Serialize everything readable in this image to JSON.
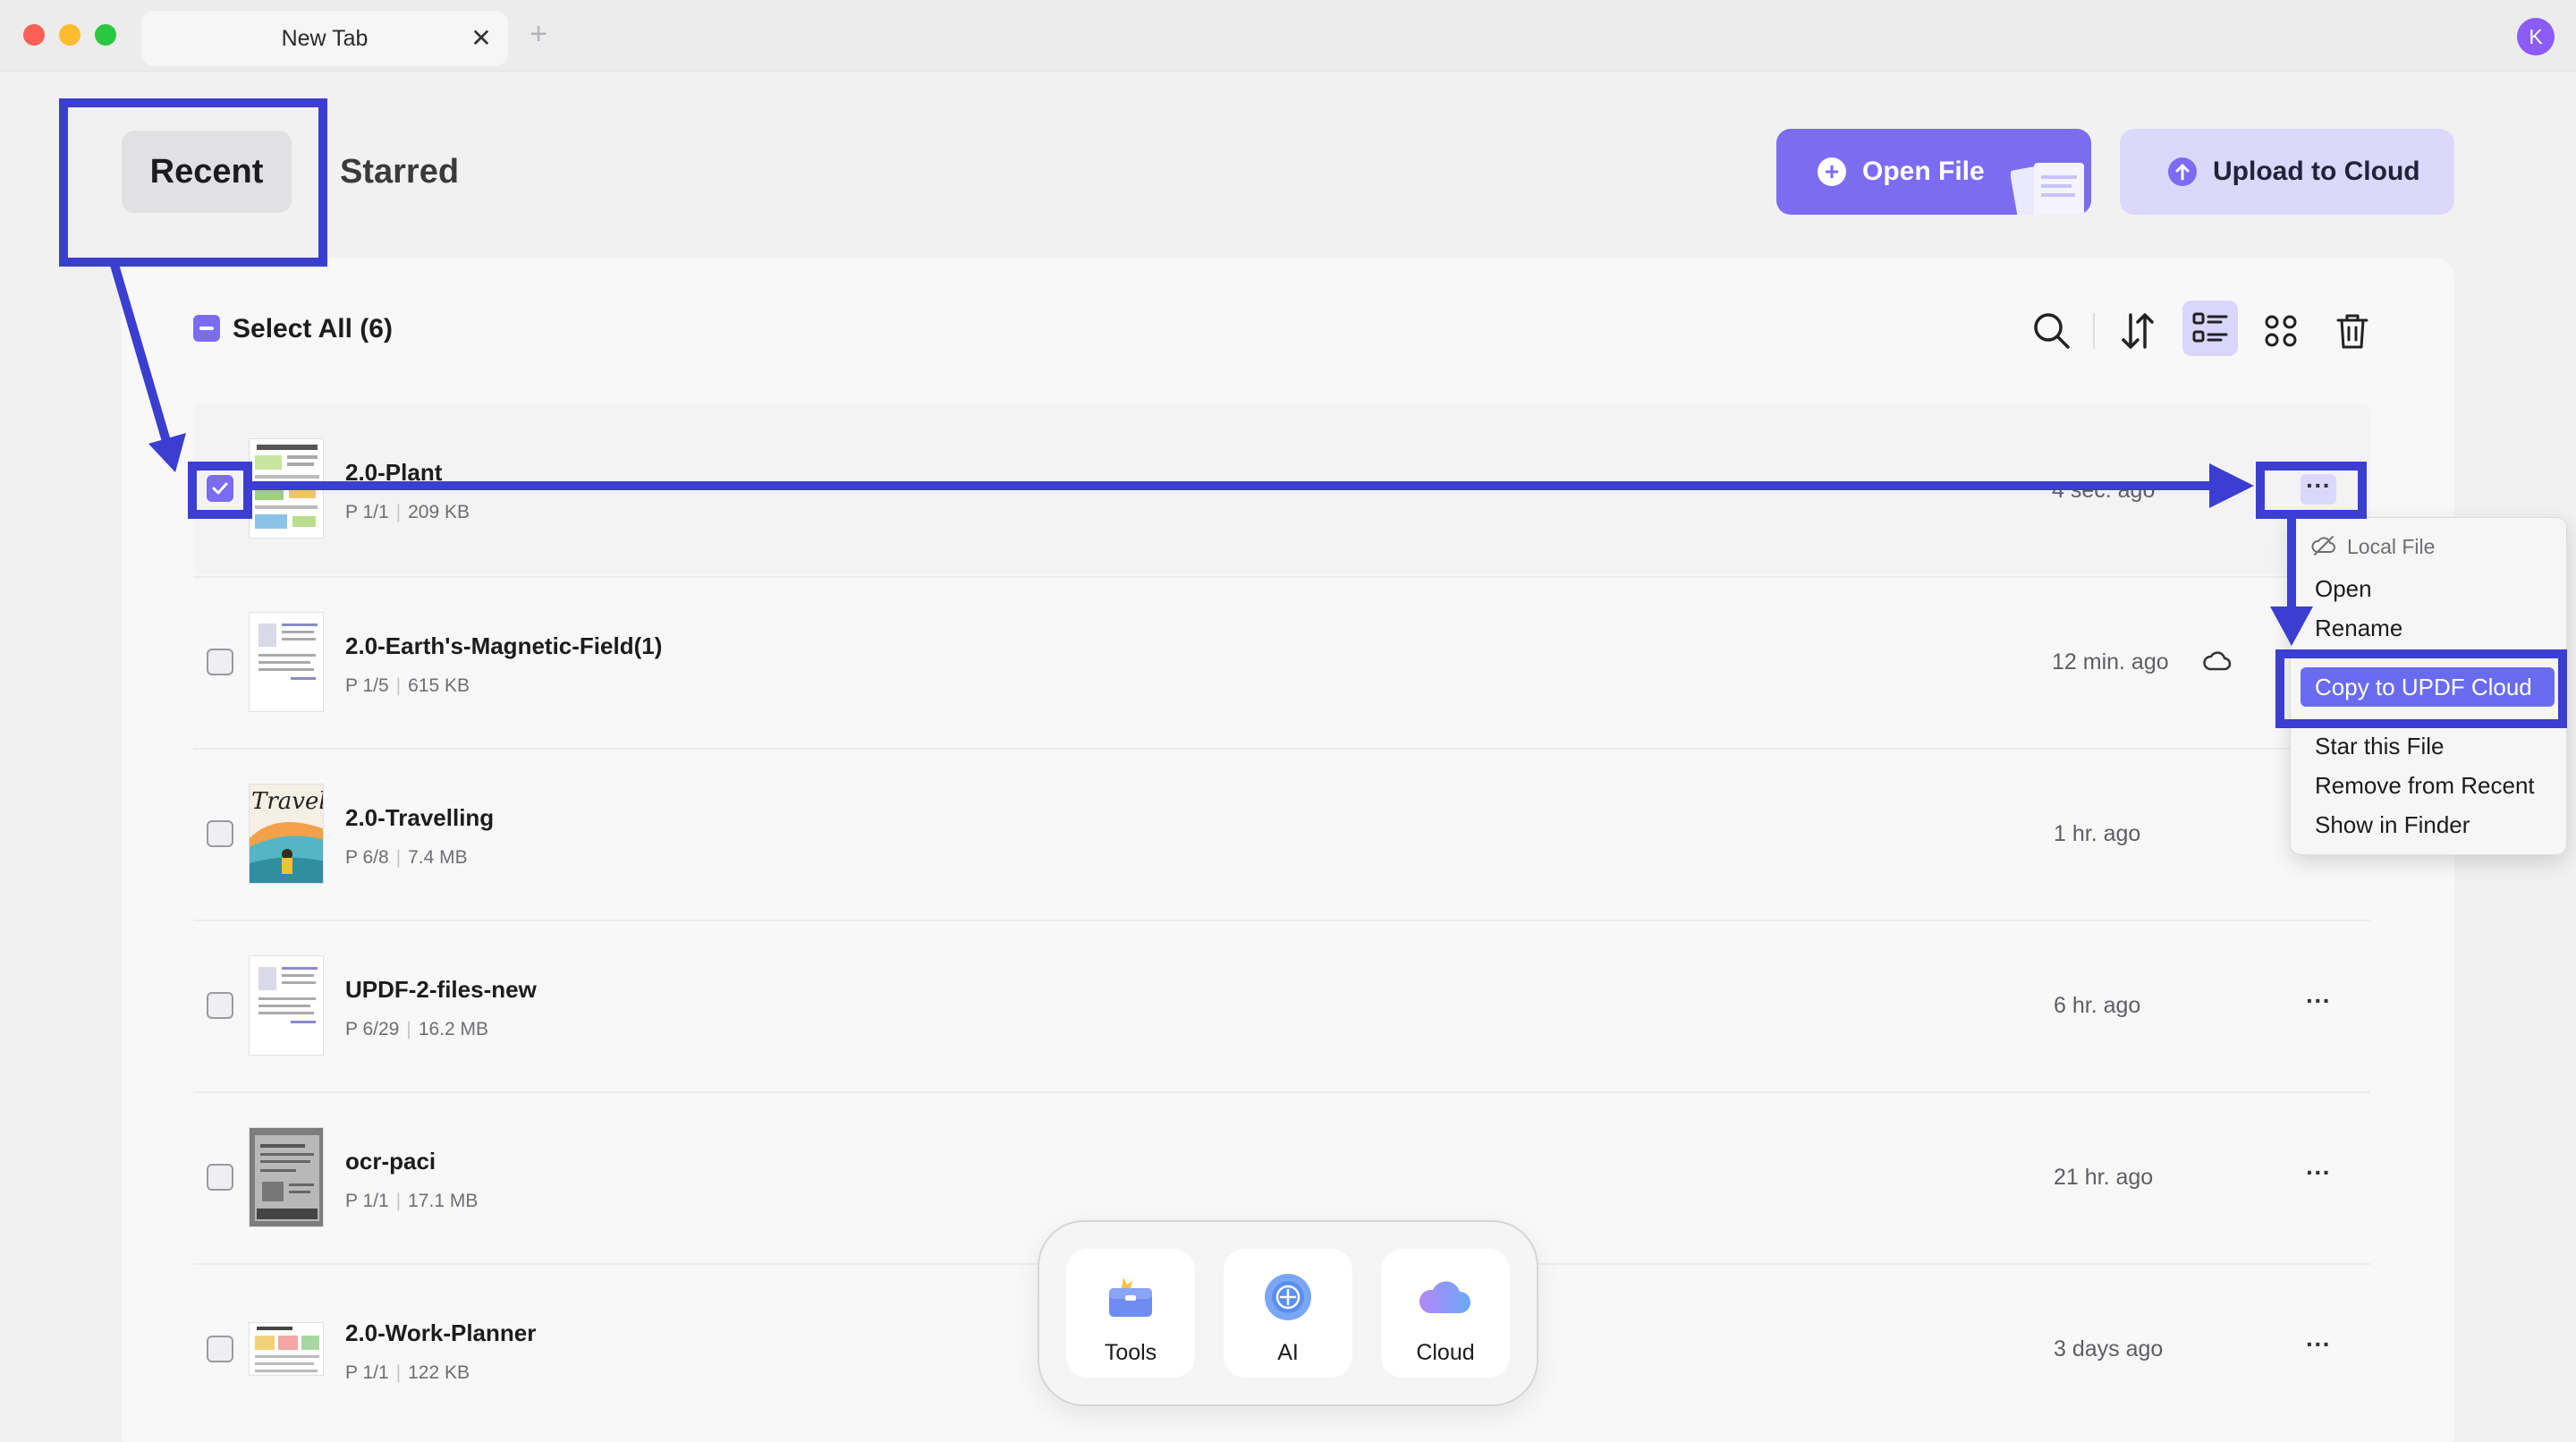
{
  "window": {
    "tab_title": "New Tab",
    "tab_close": "✕",
    "new_tab": "+",
    "avatar_initial": "K"
  },
  "nav": {
    "recent": "Recent",
    "starred": "Starred"
  },
  "actions": {
    "open_file": "Open File",
    "upload_to_cloud": "Upload to Cloud"
  },
  "toolbar": {
    "select_all": "Select All (6)"
  },
  "files": [
    {
      "name": "2.0-Plant",
      "pages": "P 1/1",
      "size": "209 KB",
      "time": "4 sec. ago",
      "checked": true
    },
    {
      "name": "2.0-Earth's-Magnetic-Field(1)",
      "pages": "P 1/5",
      "size": "615 KB",
      "time": "12 min. ago",
      "checked": false
    },
    {
      "name": "2.0-Travelling",
      "pages": "P 6/8",
      "size": "7.4 MB",
      "time": "1 hr. ago",
      "checked": false
    },
    {
      "name": "UPDF-2-files-new",
      "pages": "P 6/29",
      "size": "16.2 MB",
      "time": "6 hr. ago",
      "checked": false
    },
    {
      "name": "ocr-paci",
      "pages": "P 1/1",
      "size": "17.1 MB",
      "time": "21 hr. ago",
      "checked": false
    },
    {
      "name": "2.0-Work-Planner",
      "pages": "P 1/1",
      "size": "122 KB",
      "time": "3 days ago",
      "checked": false
    }
  ],
  "thumbnail_text": {
    "travel": "Travel"
  },
  "context_menu": {
    "header": "Local File",
    "items": [
      "Open",
      "Rename",
      "Copy to UPDF Cloud",
      "Star this File",
      "Remove from Recent",
      "Show in Finder"
    ]
  },
  "dock": {
    "tools": "Tools",
    "ai": "AI",
    "cloud": "Cloud"
  },
  "colors": {
    "accent": "#7c6cf2",
    "annotation": "#3b3ed0",
    "menu_highlight": "#6a6cf0"
  }
}
